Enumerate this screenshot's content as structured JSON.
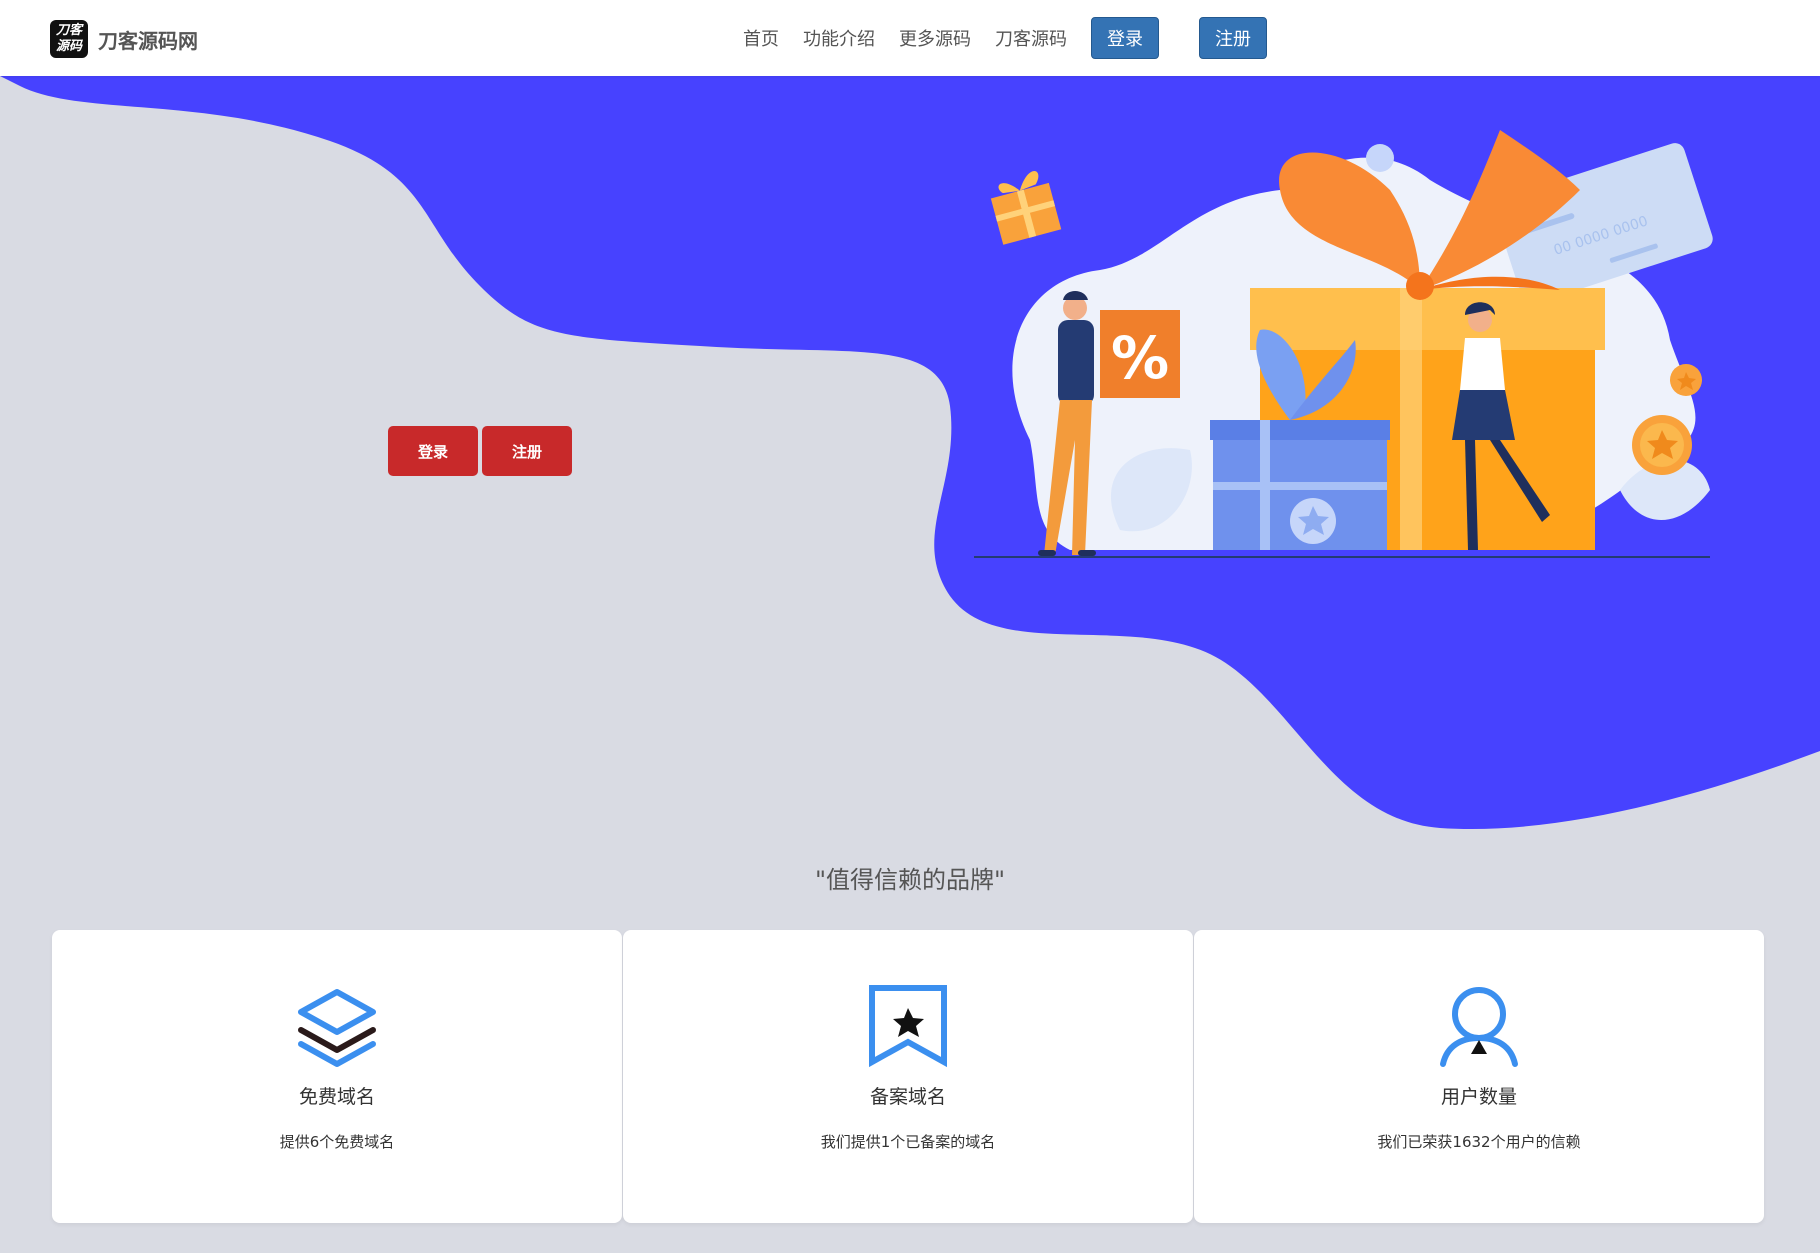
{
  "brand": {
    "logo_line1": "刀客",
    "logo_line2": "源码",
    "name": "刀客源码网"
  },
  "nav": {
    "links": [
      "首页",
      "功能介绍",
      "更多源码",
      "刀客源码"
    ],
    "login": "登录",
    "register": "注册"
  },
  "hero": {
    "login": "登录",
    "register": "注册",
    "percent_sign": "%",
    "card_number": "00 0000 0000"
  },
  "section": {
    "title": "\"值得信赖的品牌\""
  },
  "cards": [
    {
      "icon": "layers-icon",
      "title": "免费域名",
      "desc": "提供6个免费域名"
    },
    {
      "icon": "bookmark-star-icon",
      "title": "备案域名",
      "desc": "我们提供1个已备案的域名"
    },
    {
      "icon": "user-icon",
      "title": "用户数量",
      "desc": "我们已荣获1632个用户的信赖"
    }
  ],
  "colors": {
    "hero_blue": "#4742ff",
    "background": "#d9dbe3",
    "button_red": "#c8292a",
    "nav_button": "#3473b4",
    "icon_blue": "#3b8fef"
  }
}
